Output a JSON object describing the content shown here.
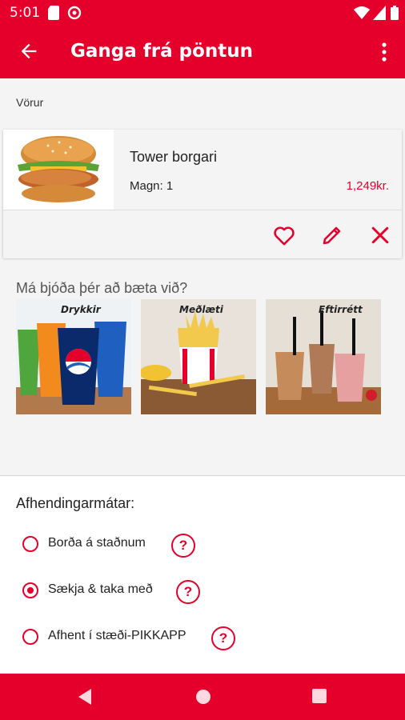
{
  "status_bar": {
    "time": "5:01"
  },
  "app_bar": {
    "title": "Ganga frá pöntun"
  },
  "cart": {
    "section_label": "Vörur",
    "items": [
      {
        "name": "Tower borgari",
        "quantity": "Magn: 1",
        "price": "1,249kr."
      }
    ]
  },
  "upsell": {
    "title": "Má bjóða þér að bæta við?",
    "items": [
      {
        "caption": "Drykkir"
      },
      {
        "caption": "Meðlæti"
      },
      {
        "caption": "Eftirrétt"
      }
    ]
  },
  "delivery": {
    "title": "Afhendingarmátar:",
    "options": [
      {
        "label": "Borða á staðnum",
        "selected": false,
        "help": "?"
      },
      {
        "label": "Sækja & taka með",
        "selected": true,
        "help": "?"
      },
      {
        "label": "Afhent í stæði-PIKKAPP",
        "selected": false,
        "help": "?"
      }
    ]
  },
  "colors": {
    "brand_red": "#e4002b",
    "background": "#f4f4f4"
  }
}
